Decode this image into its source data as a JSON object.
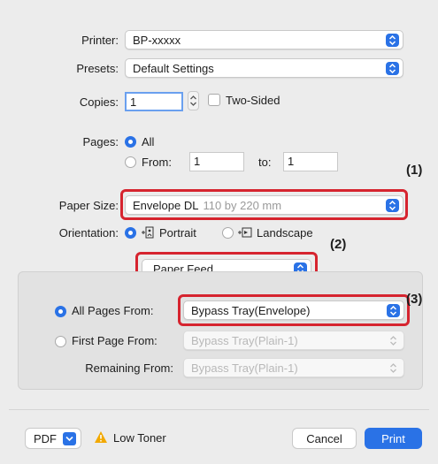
{
  "printer": {
    "label": "Printer:",
    "value": "BP-xxxxx"
  },
  "presets": {
    "label": "Presets:",
    "value": "Default Settings"
  },
  "copies": {
    "label": "Copies:",
    "value": "1",
    "two_sided_label": "Two-Sided"
  },
  "pages": {
    "label": "Pages:",
    "all_label": "All",
    "from_label": "From:",
    "from_value": "1",
    "to_label": "to:",
    "to_value": "1"
  },
  "paper_size": {
    "label": "Paper Size:",
    "value": "Envelope DL",
    "detail": "110 by 220 mm"
  },
  "orientation": {
    "label": "Orientation:",
    "portrait_label": "Portrait",
    "landscape_label": "Landscape"
  },
  "section_popup": {
    "value": "Paper Feed"
  },
  "paper_feed": {
    "all_pages_label": "All Pages From:",
    "all_pages_value": "Bypass Tray(Envelope)",
    "first_page_label": "First Page From:",
    "first_page_value": "Bypass Tray(Plain-1)",
    "remaining_label": "Remaining From:",
    "remaining_value": "Bypass Tray(Plain-1)"
  },
  "callouts": {
    "c1": "(1)",
    "c2": "(2)",
    "c3": "(3)"
  },
  "footer": {
    "pdf_label": "PDF",
    "warning_text": "Low Toner",
    "cancel_label": "Cancel",
    "print_label": "Print"
  },
  "colors": {
    "accent": "#2a72e6",
    "highlight": "#d6242f",
    "warning": "#f2a900"
  }
}
